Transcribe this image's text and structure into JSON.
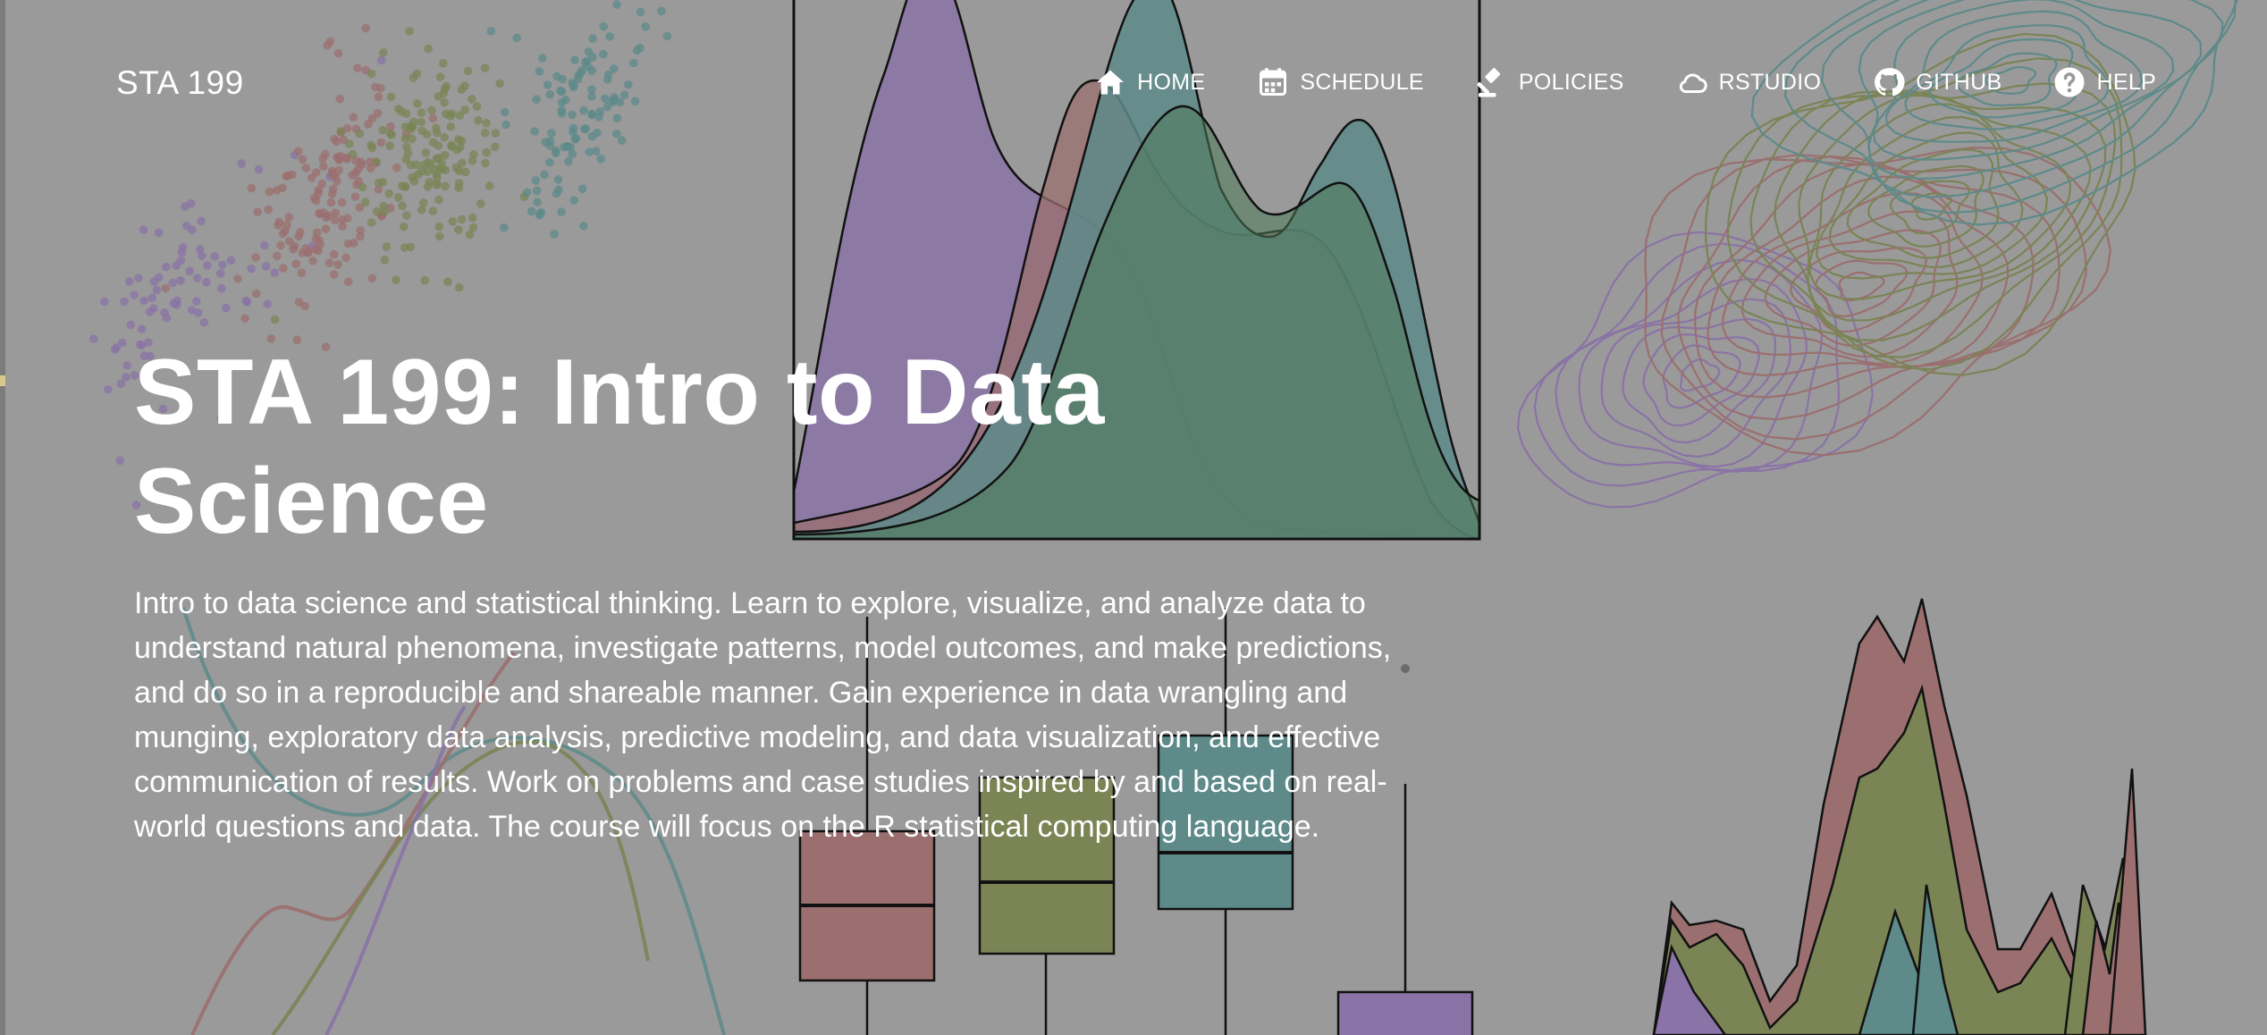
{
  "brand": "STA 199",
  "nav": [
    {
      "label": "HOME",
      "icon": "home-icon"
    },
    {
      "label": "SCHEDULE",
      "icon": "calendar-icon"
    },
    {
      "label": "POLICIES",
      "icon": "gavel-icon"
    },
    {
      "label": "RSTUDIO",
      "icon": "cloud-icon"
    },
    {
      "label": "GITHUB",
      "icon": "github-icon"
    },
    {
      "label": "HELP",
      "icon": "question-icon"
    }
  ],
  "hero": {
    "title": "STA 199: Intro to Data Science",
    "description": "Intro to data science and statistical thinking. Learn to explore, visualize, and analyze data to understand natural phenomena, investigate patterns, model outcomes, and make predictions, and do so in a reproducible and shareable manner. Gain experience in data wrangling and munging, exploratory data analysis, predictive modeling, and data visualization, and effective communication of results. Work on problems and case studies inspired by and based on real-world questions and data. The course will focus on the R statistical computing language."
  },
  "colors": {
    "background": "#9a9a9a",
    "red": "#9b6f6f",
    "olive": "#7a8455",
    "teal": "#5e8a8a",
    "purple": "#8a73a6"
  }
}
